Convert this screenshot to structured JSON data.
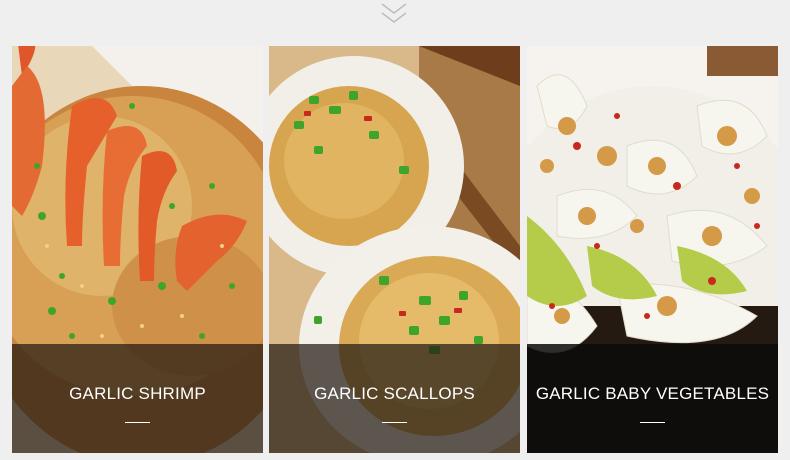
{
  "cards": [
    {
      "title": "GARLIC SHRIMP",
      "photo_icon": "garlic-shrimp-photo"
    },
    {
      "title": "GARLIC SCALLOPS",
      "photo_icon": "garlic-scallops-photo"
    },
    {
      "title": "GARLIC BABY VEGETABLES",
      "photo_icon": "garlic-baby-vegetables-photo"
    }
  ],
  "scroll_hint_icon": "double-chevron-down-icon",
  "colors": {
    "page_background": "#efefef",
    "caption_text": "#ffffff",
    "caption_overlay": "#231b14",
    "garlic_gold": "#d29a4c",
    "scallion_green": "#3fa52a",
    "chili_red": "#c8281e"
  }
}
